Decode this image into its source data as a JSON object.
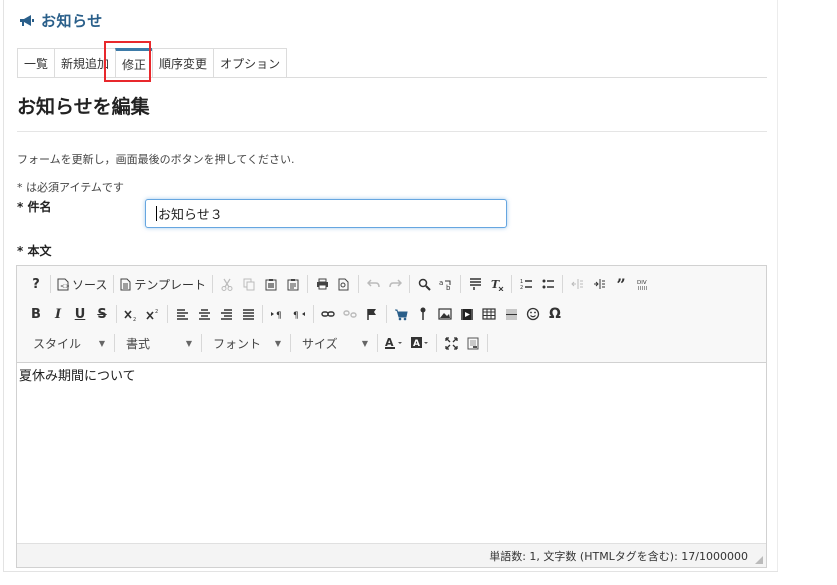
{
  "header": {
    "title": "お知らせ",
    "icon": "megaphone-icon",
    "color": "#2a5f8a"
  },
  "tabs": [
    {
      "label": "一覧",
      "active": false
    },
    {
      "label": "新規追加",
      "active": false
    },
    {
      "label": "修正",
      "active": true
    },
    {
      "label": "順序変更",
      "active": false
    },
    {
      "label": "オプション",
      "active": false
    }
  ],
  "page": {
    "title": "お知らせを編集",
    "description": "フォームを更新し，画面最後のボタンを押してください.",
    "required_note": "* は必須アイテムです"
  },
  "form": {
    "subject_label": "* 件名",
    "subject_value": "お知らせ３",
    "body_label": "* 本文"
  },
  "editor": {
    "toolbar": {
      "source_label": "ソース",
      "template_label": "テンプレート",
      "style_combo": "スタイル",
      "format_combo": "書式",
      "font_combo": "フォント",
      "size_combo": "サイズ"
    },
    "content": "夏休み期間について",
    "status": "単語数: 1, 文字数 (HTMLタグを含む): 17/1000000"
  },
  "colors": {
    "accent": "#3d7ba8",
    "highlight": "#e8282c",
    "focus": "#66a6e0"
  }
}
